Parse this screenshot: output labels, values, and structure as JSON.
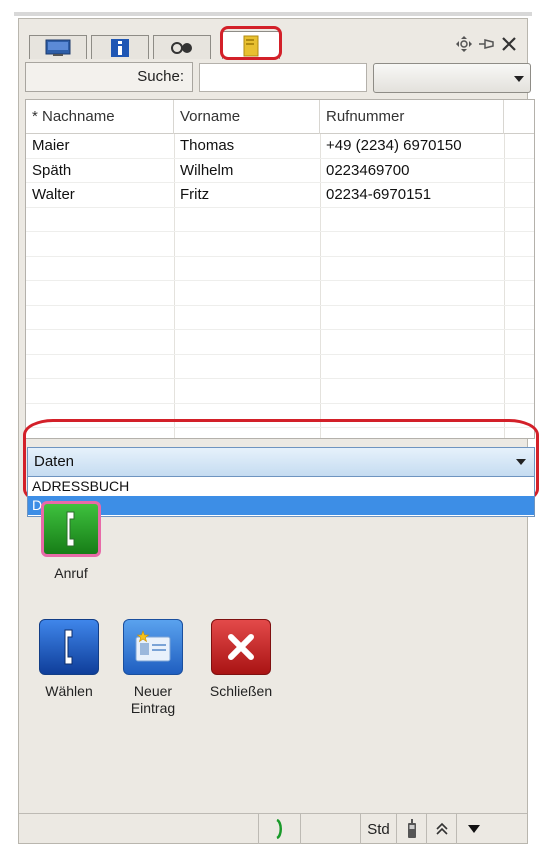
{
  "tabs": [
    {
      "icon": "monitor-icon"
    },
    {
      "icon": "info-icon"
    },
    {
      "icon": "glasses-icon"
    },
    {
      "icon": "address-book-icon"
    }
  ],
  "header_icons": [
    "move-icon",
    "pin-icon",
    "close-icon"
  ],
  "search": {
    "label": "Suche:",
    "value": "",
    "filter_value": ""
  },
  "table": {
    "columns": [
      "* Nachname",
      "Vorname",
      "Rufnummer"
    ],
    "rows": [
      [
        "Maier",
        "Thomas",
        "+49 (2234) 6970150"
      ],
      [
        "Späth",
        "Wilhelm",
        "0223469700"
      ],
      [
        "Walter",
        "Fritz",
        "02234-6970151"
      ]
    ]
  },
  "source_dropdown": {
    "selected": "Daten",
    "options": [
      "ADRESSBUCH",
      "Daten"
    ]
  },
  "actions": {
    "call": "Anruf",
    "dial": "Wählen",
    "new_entry": "Neuer Eintrag",
    "close": "Schließen"
  },
  "statusbar": {
    "mode": "Std"
  },
  "colors": {
    "highlight": "#d32029",
    "selection": "#3d8ee6"
  }
}
